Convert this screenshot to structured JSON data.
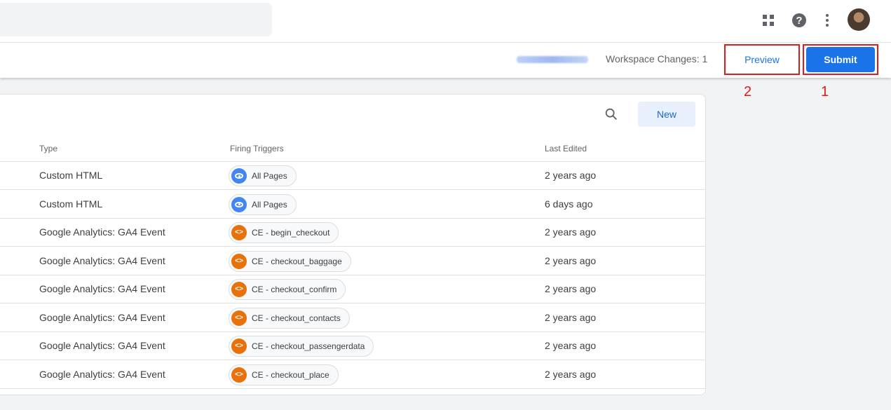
{
  "header": {
    "icons": [
      "apps-grid-icon",
      "help-icon",
      "more-vert-icon",
      "avatar"
    ]
  },
  "toolbar": {
    "workspace_changes": "Workspace Changes: 1",
    "preview_label": "Preview",
    "submit_label": "Submit"
  },
  "annotations": {
    "preview_marker": "2",
    "submit_marker": "1",
    "color": "#e01b1b"
  },
  "table": {
    "new_label": "New",
    "columns": [
      "Type",
      "Firing Triggers",
      "Last Edited"
    ],
    "rows": [
      {
        "type": "Custom HTML",
        "trigger": "All Pages",
        "trigger_icon": "eye-icon",
        "last_edited": "2 years ago"
      },
      {
        "type": "Custom HTML",
        "trigger": "All Pages",
        "trigger_icon": "eye-icon",
        "last_edited": "6 days ago"
      },
      {
        "type": "Google Analytics: GA4 Event",
        "trigger": "CE - begin_checkout",
        "trigger_icon": "code-icon",
        "last_edited": "2 years ago"
      },
      {
        "type": "Google Analytics: GA4 Event",
        "trigger": "CE - checkout_baggage",
        "trigger_icon": "code-icon",
        "last_edited": "2 years ago"
      },
      {
        "type": "Google Analytics: GA4 Event",
        "trigger": "CE - checkout_confirm",
        "trigger_icon": "code-icon",
        "last_edited": "2 years ago"
      },
      {
        "type": "Google Analytics: GA4 Event",
        "trigger": "CE - checkout_contacts",
        "trigger_icon": "code-icon",
        "last_edited": "2 years ago"
      },
      {
        "type": "Google Analytics: GA4 Event",
        "trigger": "CE - checkout_passengerdata",
        "trigger_icon": "code-icon",
        "last_edited": "2 years ago"
      },
      {
        "type": "Google Analytics: GA4 Event",
        "trigger": "CE - checkout_place",
        "trigger_icon": "code-icon",
        "last_edited": "2 years ago"
      }
    ]
  },
  "colors": {
    "primary": "#1a73e8",
    "page_icon": "#4285f4",
    "custom_event_icon": "#e8710a"
  }
}
